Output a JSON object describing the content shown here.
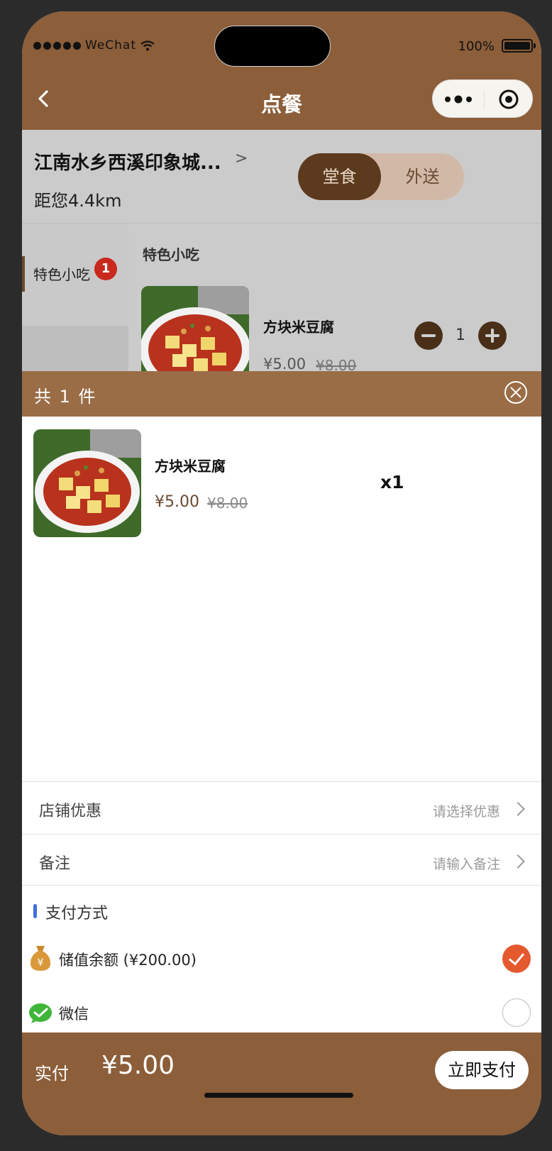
{
  "status_bar": {
    "carrier": "WeChat",
    "battery": "100%"
  },
  "nav": {
    "title": "点餐"
  },
  "store": {
    "name": "江南水乡西溪印象城...",
    "arrow": ">",
    "distance": "距您4.4km"
  },
  "mode": {
    "dine_in": "堂食",
    "delivery": "外送",
    "selected": "dine_in"
  },
  "menu": {
    "category": "特色小吃",
    "category_badge": "1",
    "section_title": "特色小吃",
    "item": {
      "name": "方块米豆腐",
      "price": "¥5.00",
      "original_price": "¥8.00",
      "quantity": "1"
    }
  },
  "cart": {
    "count_label": "共 1 件",
    "items": [
      {
        "name": "方块米豆腐",
        "price": "¥5.00",
        "original_price": "¥8.00",
        "qty": "x1"
      }
    ]
  },
  "options": {
    "discount": {
      "label": "店铺优惠",
      "hint": "请选择优惠"
    },
    "remark": {
      "label": "备注",
      "hint": "请输入备注"
    }
  },
  "payment": {
    "title": "支付方式",
    "methods": [
      {
        "label": "储值余额 (¥200.00)",
        "icon": "money-bag-icon",
        "selected": true
      },
      {
        "label": "微信",
        "icon": "wechat-pay-icon",
        "selected": false
      }
    ]
  },
  "footer": {
    "total_label": "实付",
    "total_value": "¥5.00",
    "pay_button": "立即支付"
  },
  "colors": {
    "brand": "#8c5e3a",
    "accent": "#e5592f",
    "badge": "#c8281e"
  }
}
